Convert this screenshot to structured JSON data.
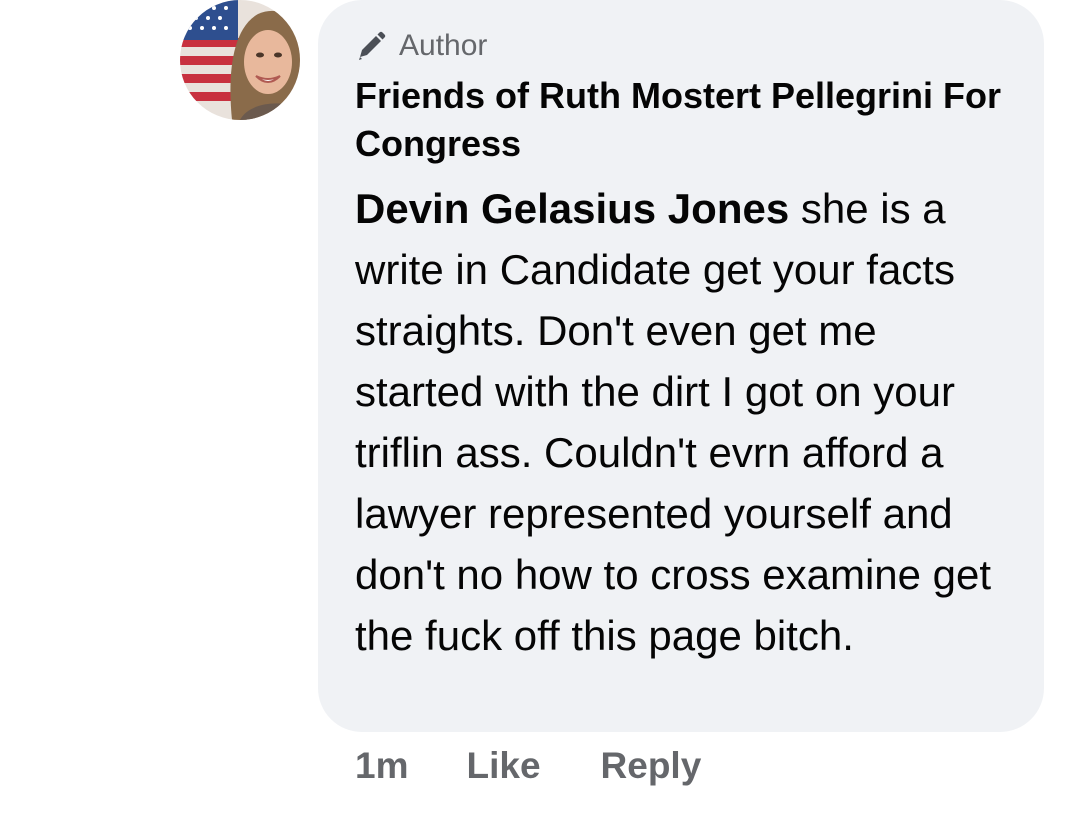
{
  "comment": {
    "badge": "Author",
    "page_name": "Friends of Ruth Mostert Pellegrini For Congress",
    "mention": "Devin Gelasius Jones",
    "text": " she is a write in Candidate get your facts straights. Don't even get me started with the dirt I got on your triflin ass. Couldn't evrn afford a lawyer represented yourself and don't no how to cross examine get the fuck off this page bitch.",
    "bubble_color": "#f0f2f5"
  },
  "actions": {
    "time": "1m",
    "like": "Like",
    "reply": "Reply"
  },
  "icons": {
    "author_badge": "pencil-icon",
    "avatar": "profile-photo"
  }
}
